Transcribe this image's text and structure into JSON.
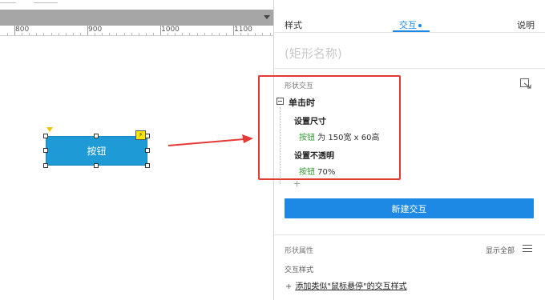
{
  "ruler": {
    "labels": [
      "800",
      "900",
      "1000",
      "1100"
    ]
  },
  "canvas": {
    "shape_label": "按钮"
  },
  "panel": {
    "tabs": [
      {
        "label": "样式"
      },
      {
        "label": "交互"
      },
      {
        "label": "说明"
      }
    ],
    "shape_name_placeholder": "(矩形名称)",
    "interactions_section": "形状交互",
    "event": "单击时",
    "actions": [
      {
        "title": "设置尺寸",
        "target": "按钮",
        "detail": " 为 150宽 x 60高"
      },
      {
        "title": "设置不透明",
        "target": "按钮",
        "detail": " 70%"
      }
    ],
    "add_action": "+",
    "new_interaction_button": "新建交互",
    "properties_section": "形状属性",
    "show_all": "显示全部",
    "interaction_styles_label": "交互样式",
    "add_style_link": "添加类似\"鼠标悬停\"的交互样式"
  },
  "colors": {
    "accent": "#1e88e5",
    "shape_fill": "#1e9ad6",
    "highlight_box": "#e53935",
    "target_text": "#2e9d2e"
  },
  "icons": [
    "chevron-down-icon",
    "lightning-icon",
    "collapse-icon",
    "expand-panel-icon",
    "menu-icon",
    "plus-icon"
  ]
}
